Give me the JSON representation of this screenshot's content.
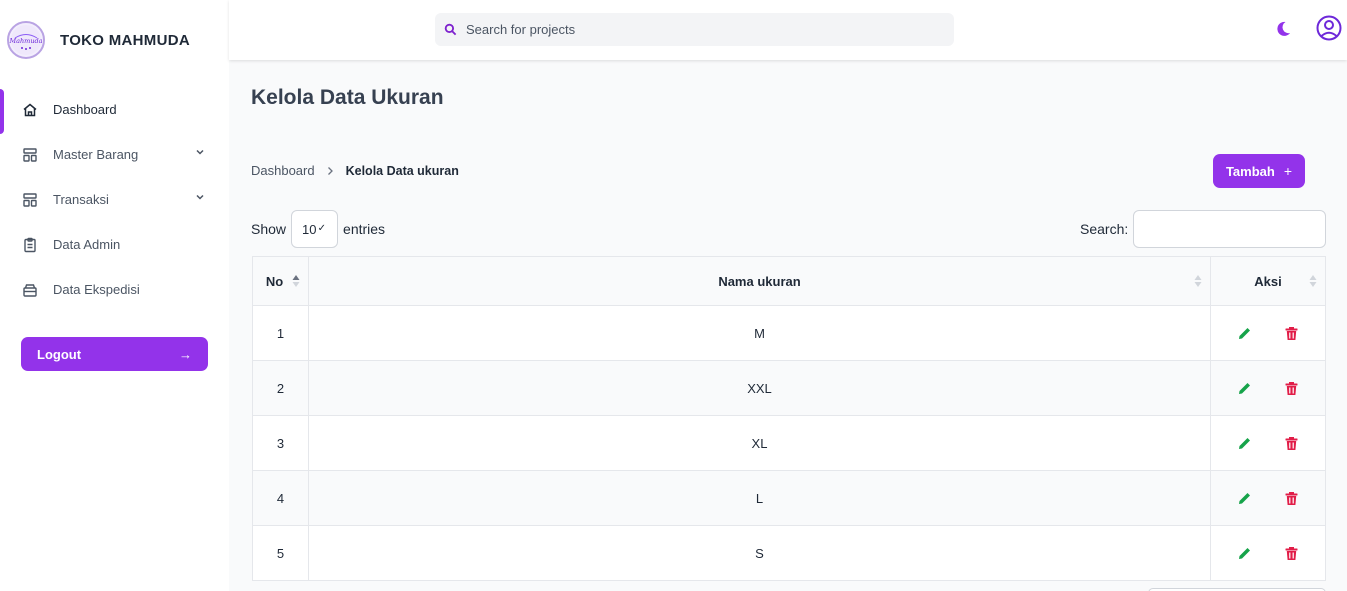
{
  "brand": {
    "name": "TOKO MAHMUDA",
    "logo_text": "Mahmuda"
  },
  "sidebar": {
    "items": [
      {
        "label": "Dashboard",
        "icon": "home-icon",
        "active": true
      },
      {
        "label": "Master Barang",
        "icon": "template-icon",
        "has_submenu": true
      },
      {
        "label": "Transaksi",
        "icon": "template-icon",
        "has_submenu": true
      },
      {
        "label": "Data Admin",
        "icon": "clipboard-icon"
      },
      {
        "label": "Data Ekspedisi",
        "icon": "archive-icon"
      }
    ],
    "logout_label": "Logout",
    "logout_arrow": "→"
  },
  "header": {
    "search_placeholder": "Search for projects"
  },
  "page": {
    "title": "Kelola Data Ukuran",
    "breadcrumb_home": "Dashboard",
    "breadcrumb_current": "Kelola Data ukuran",
    "add_button": "Tambah",
    "add_button_icon": "+"
  },
  "table_controls": {
    "show_label": "Show",
    "entries_value": "10",
    "entries_label": "entries",
    "search_label": "Search:"
  },
  "table": {
    "headers": [
      "No",
      "Nama ukuran",
      "Aksi"
    ],
    "rows": [
      {
        "no": "1",
        "nama": "M"
      },
      {
        "no": "2",
        "nama": "XXL"
      },
      {
        "no": "3",
        "nama": "XL"
      },
      {
        "no": "4",
        "nama": "L"
      },
      {
        "no": "5",
        "nama": "S"
      }
    ]
  },
  "colors": {
    "accent": "#9333ea",
    "edit": "#16a34a",
    "delete": "#e11d48"
  }
}
